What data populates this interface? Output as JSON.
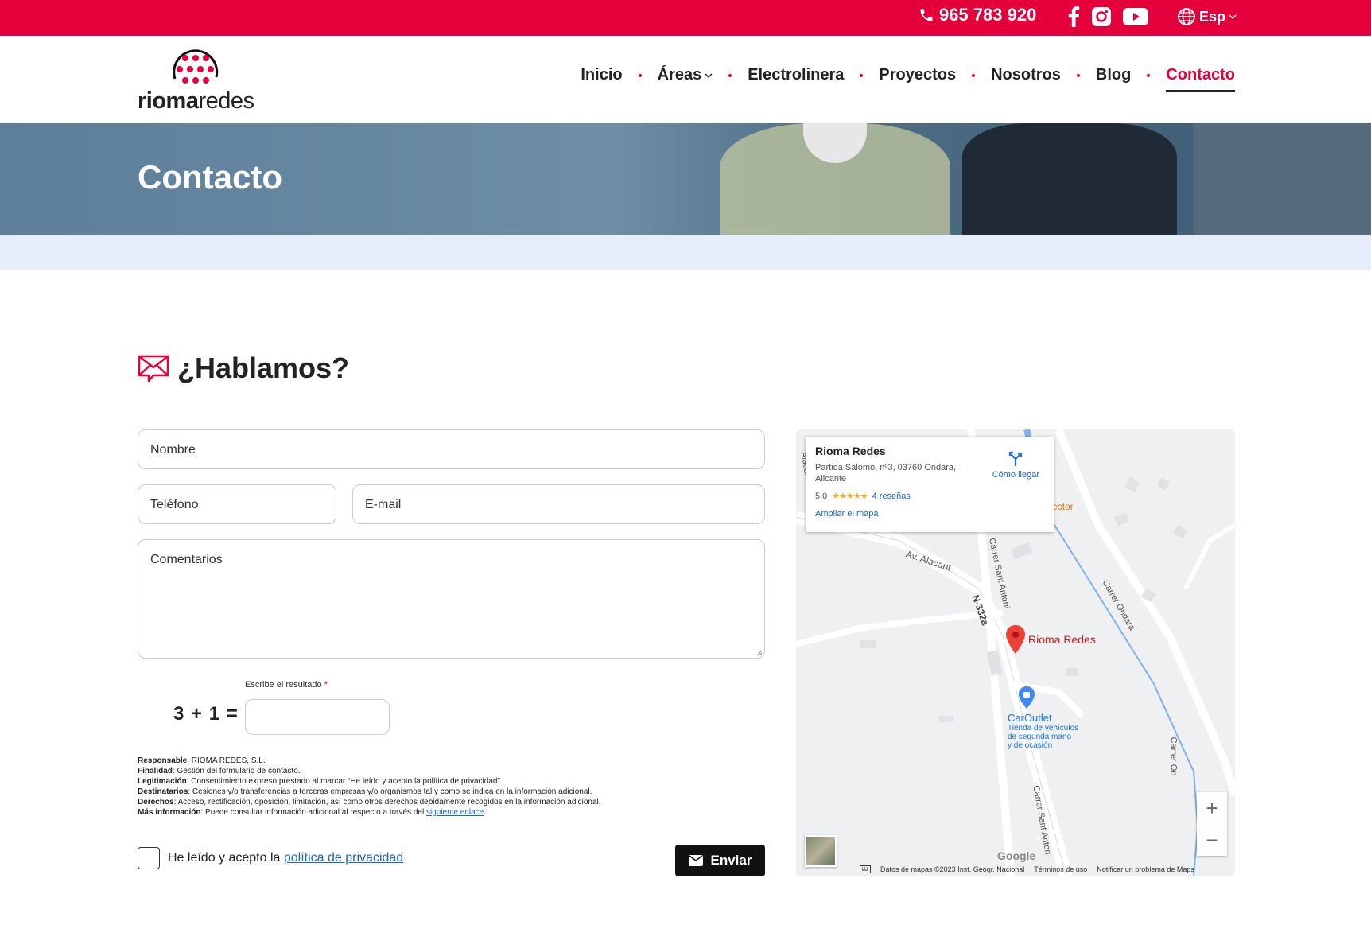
{
  "topbar": {
    "phone": "965 783 920",
    "language": "Esp",
    "social": [
      "facebook-icon",
      "instagram-icon",
      "youtube-icon"
    ]
  },
  "logo": {
    "bold": "rioma",
    "light": "redes"
  },
  "nav": {
    "items": [
      {
        "label": "Inicio"
      },
      {
        "label": "Áreas"
      },
      {
        "label": "Electrolinera"
      },
      {
        "label": "Proyectos"
      },
      {
        "label": "Nosotros"
      },
      {
        "label": "Blog"
      },
      {
        "label": "Contacto"
      }
    ]
  },
  "hero": {
    "title": "Contacto"
  },
  "section": {
    "title": "¿Hablamos?"
  },
  "form": {
    "name_placeholder": "Nombre",
    "phone_placeholder": "Teléfono",
    "email_placeholder": "E-mail",
    "comments_placeholder": "Comentarios",
    "captcha_label": "Escribe el resultado",
    "captcha_required": "*",
    "captcha_equation": "3 + 1 =",
    "checkbox_text": "He leído y acepto la",
    "checkbox_link": "política de privacidad",
    "submit_label": "Enviar"
  },
  "legal": [
    {
      "key": "Responsable",
      "text": ": RIOMA REDES, S.L."
    },
    {
      "key": "Finalidad",
      "text": ": Gestión del formulario de contacto."
    },
    {
      "key": "Legitimación",
      "text": ": Consentimiento expreso prestado al marcar “He leído y acepto la política de privacidad”."
    },
    {
      "key": "Destinatarios",
      "text": ": Cesiones y/o transferencias a terceras empresas y/o organismos tal y como se indica en la información adicional."
    },
    {
      "key": "Derechos",
      "text": ": Acceso, rectificación, oposición, limitación, así como otros derechos debidamente recogidos en la información adicional."
    },
    {
      "key": "Más información",
      "text": ": Puede consultar información adicional al respecto a través del ",
      "link": "siguiente enlace",
      "after": "."
    }
  ],
  "map": {
    "place_name": "Rioma Redes",
    "address": "Partida Salomo, nº3, 03760 Ondara, Alicante",
    "rating": "5,0",
    "stars": "★★★★★",
    "reviews": "4 reseñas",
    "enlarge": "Ampliar el mapa",
    "directions": "Cómo llegar",
    "marker_label": "Rioma Redes",
    "poi_name": "CarOutlet",
    "poi_desc_1": "Tienda de vehículos",
    "poi_desc_2": "de segunda mano",
    "poi_desc_3": "y de ocasión",
    "road_1": "Av. Alacant",
    "road_2": "N-332a",
    "road_3": "Carrer Sant Antoni",
    "road_4": "Carrer Ondara",
    "road_5": "Carrer Sant Anton",
    "road_6": "Carrer On",
    "road_7": "Alacant",
    "road_8": "ector",
    "footer_data": "Datos de mapas ©2023 Inst. Geogr. Nacional",
    "footer_terms": "Términos de uso",
    "footer_report": "Notificar un problema de Maps",
    "google": "Google",
    "zoom_in": "+",
    "zoom_out": "−"
  }
}
